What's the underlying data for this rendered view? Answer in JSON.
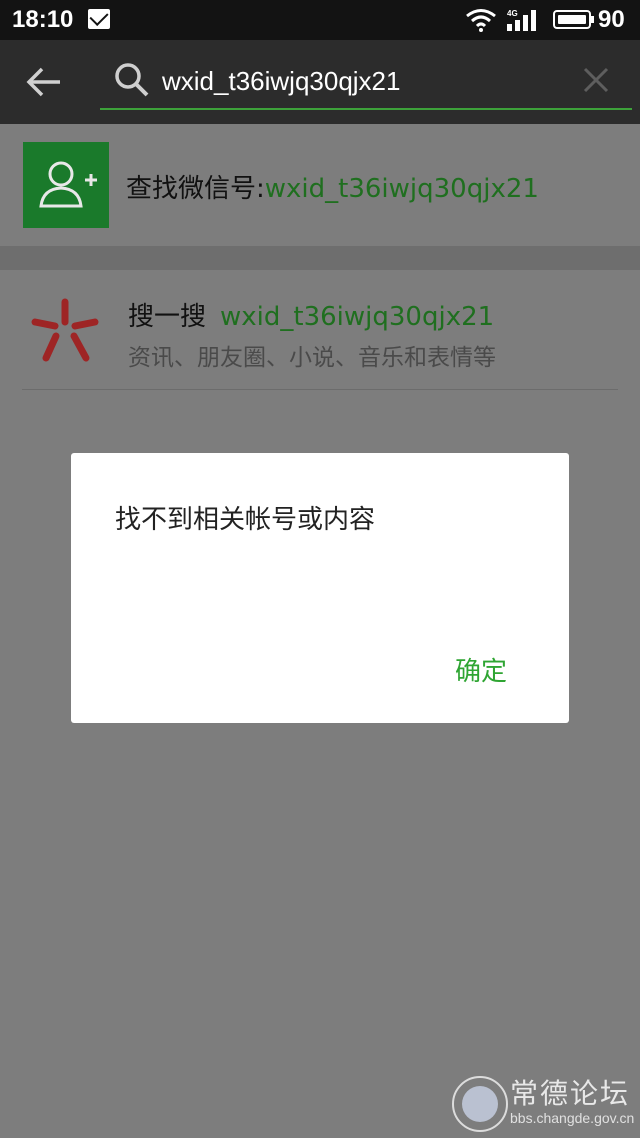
{
  "status_bar": {
    "time": "18:10",
    "network": "4G",
    "battery": "90"
  },
  "search": {
    "query": "wxid_t36iwjq30qjx21"
  },
  "results": {
    "find_account": {
      "label": "查找微信号:",
      "value": "wxid_t36iwjq30qjx21"
    },
    "sou_yi_sou": {
      "title": "搜一搜",
      "keyword": "wxid_t36iwjq30qjx21",
      "subtitle": "资讯、朋友圈、小说、音乐和表情等"
    }
  },
  "dialog": {
    "message": "找不到相关帐号或内容",
    "confirm_label": "确定"
  },
  "watermark": {
    "title": "常德论坛",
    "url": "bbs.changde.gov.cn"
  },
  "colors": {
    "accent_green": "#2fa533",
    "header_bg": "#2c2c2c",
    "status_bg": "#131313",
    "overlay_gray": "#7d7d7d",
    "sou_red": "#9e2525"
  }
}
